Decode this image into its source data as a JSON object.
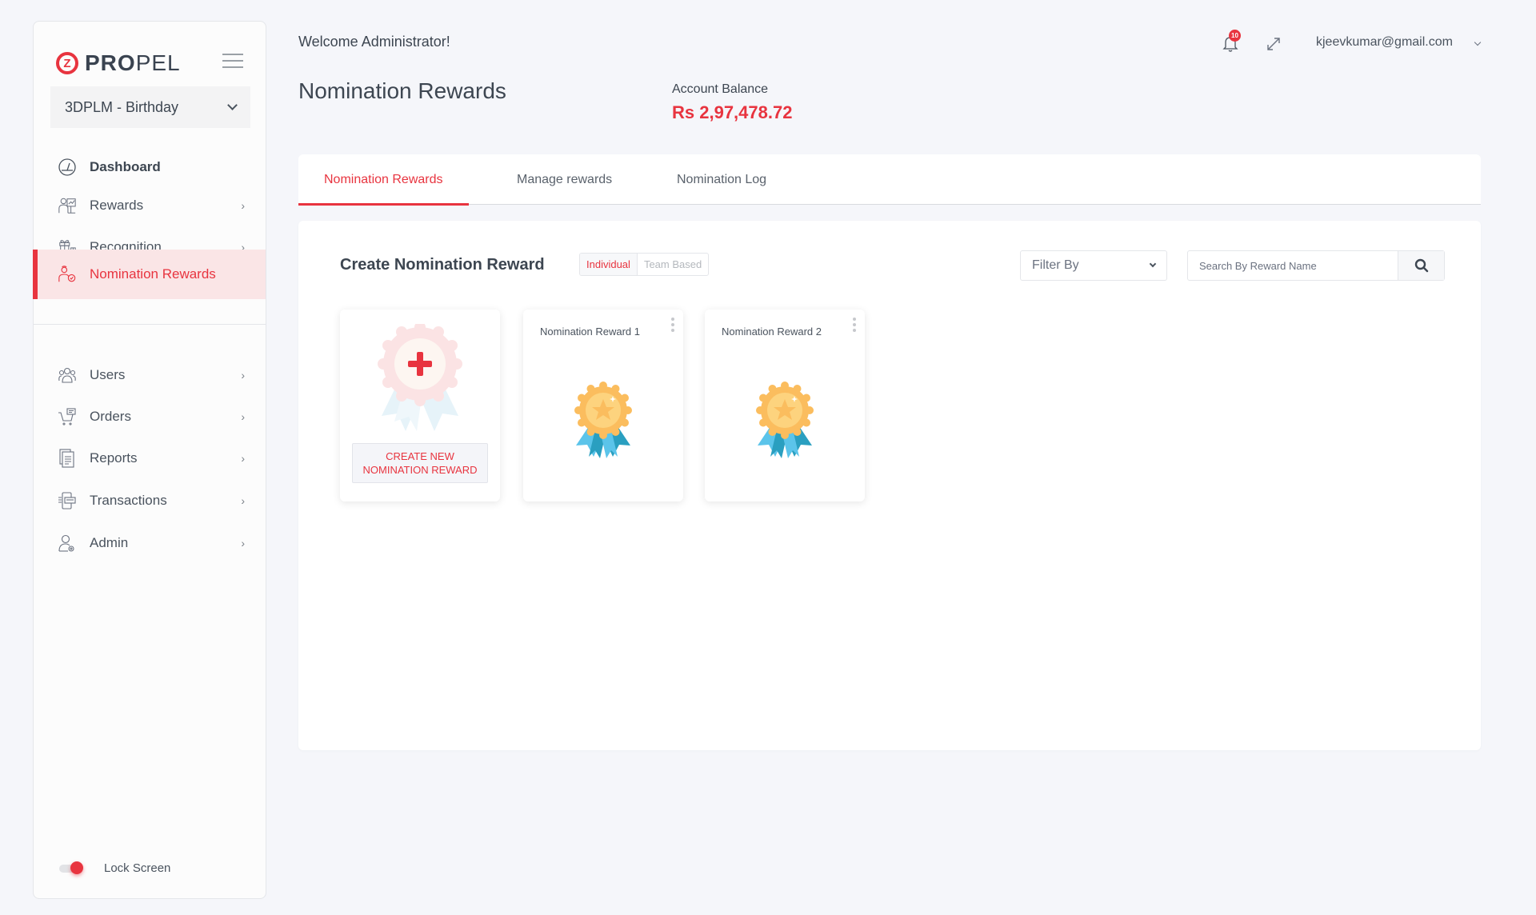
{
  "brand": {
    "logo_mark": "Z",
    "name_bold": "PRO",
    "name_light": "PEL",
    "accent": "#e8343f"
  },
  "sidebar": {
    "program_select": "3DPLM - Birthday",
    "items": [
      {
        "label": "Dashboard",
        "icon": "dashboard-gauge-icon",
        "has_arrow": false
      },
      {
        "label": "Rewards",
        "icon": "rewards-presenter-icon",
        "has_arrow": true
      },
      {
        "label": "Recognition",
        "icon": "gift-icon",
        "has_arrow": true
      },
      {
        "label": "Nomination Rewards",
        "icon": "nomination-user-badge-icon",
        "has_arrow": false,
        "active": true
      },
      {
        "label": "Users",
        "icon": "users-group-icon",
        "has_arrow": true
      },
      {
        "label": "Orders",
        "icon": "cart-icon",
        "has_arrow": true
      },
      {
        "label": "Reports",
        "icon": "document-icon",
        "has_arrow": true
      },
      {
        "label": "Transactions",
        "icon": "transactions-icon",
        "has_arrow": true
      },
      {
        "label": "Admin",
        "icon": "admin-user-gear-icon",
        "has_arrow": true
      }
    ],
    "arrow": "›",
    "lock_screen": {
      "label": "Lock Screen",
      "enabled": true
    }
  },
  "header": {
    "welcome": "Welcome Administrator!",
    "title": "Nomination Rewards",
    "balance_label": "Account Balance",
    "balance_value": "Rs 2,97,478.72",
    "notifications_count": "10",
    "user_email": "kjeevkumar@gmail.com"
  },
  "tabs": [
    {
      "label": "Nomination Rewards",
      "active": true
    },
    {
      "label": "Manage rewards",
      "active": false
    },
    {
      "label": "Nomination Log",
      "active": false
    }
  ],
  "content": {
    "section_title": "Create Nomination Reward",
    "segment": {
      "individual": "Individual",
      "team": "Team Based",
      "selected": "Individual"
    },
    "filter": {
      "placeholder": "Filter By"
    },
    "search": {
      "placeholder": "Search By Reward Name",
      "value": ""
    },
    "create_card": {
      "button_line1": "CREATE NEW",
      "button_line2": "NOMINATION REWARD"
    },
    "rewards": [
      {
        "name": "Nomination Reward 1"
      },
      {
        "name": "Nomination Reward 2"
      }
    ]
  }
}
